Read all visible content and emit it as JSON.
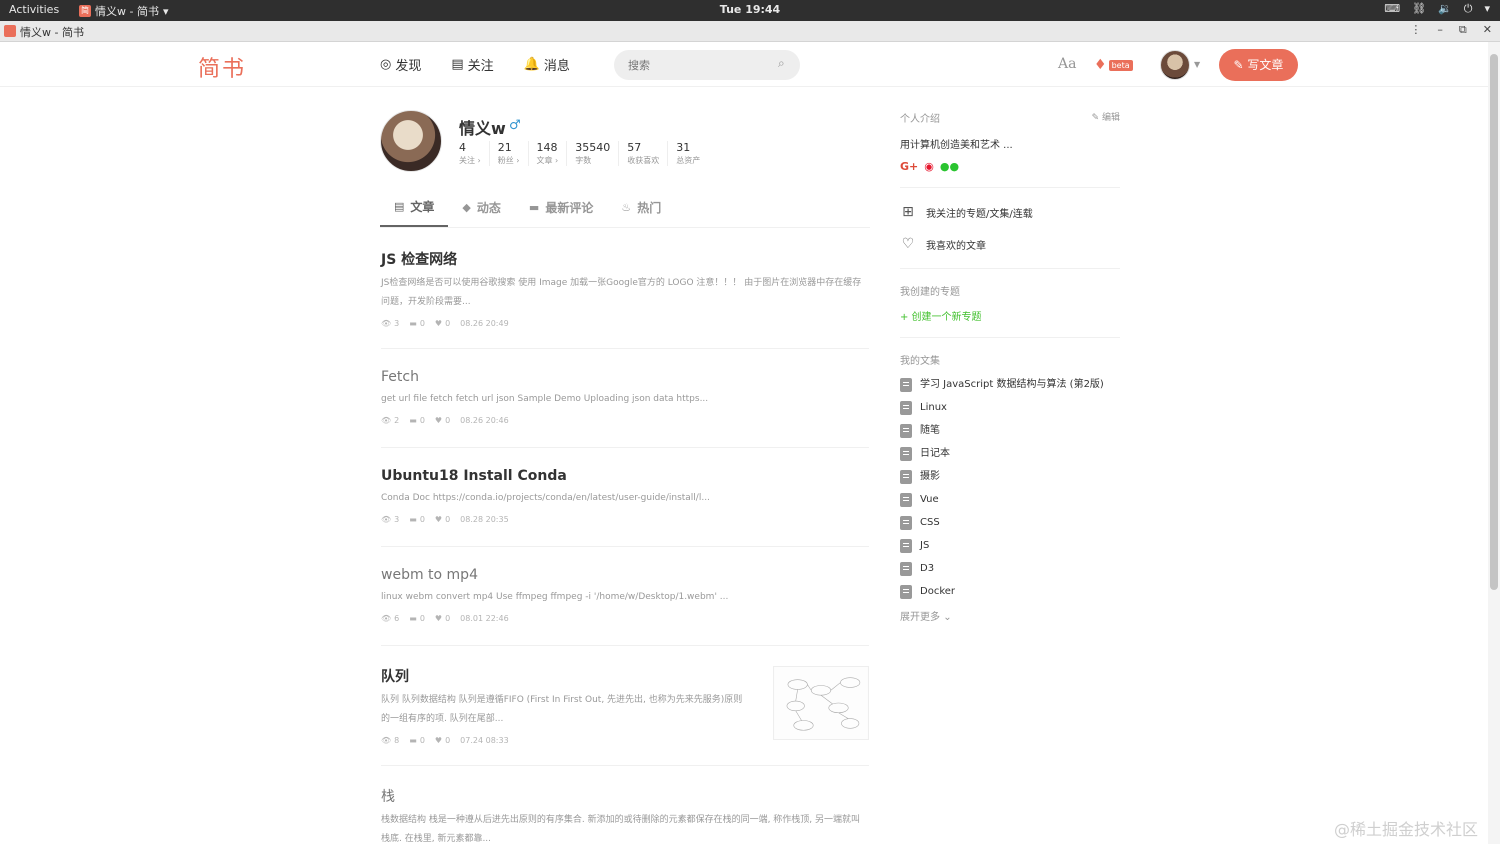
{
  "gnome": {
    "activities": "Activities",
    "app": "情义w - 简书",
    "clock": "Tue 19:44"
  },
  "browser": {
    "title": "情义w - 简书"
  },
  "header": {
    "logo": "简书",
    "nav": [
      {
        "icon": "compass-icon",
        "glyph": "◎",
        "label": "发现"
      },
      {
        "icon": "follow-icon",
        "glyph": "▤",
        "label": "关注"
      },
      {
        "icon": "bell-icon",
        "glyph": "🔔",
        "label": "消息"
      }
    ],
    "search_placeholder": "搜索",
    "font_toggle": "Aa",
    "beta": "beta",
    "write_label": "写文章",
    "accent": "#ea6f5a"
  },
  "profile": {
    "name": "情义w",
    "gender_icon": "♂",
    "stats": [
      {
        "num": "4",
        "label": "关注 ›"
      },
      {
        "num": "21",
        "label": "粉丝 ›"
      },
      {
        "num": "148",
        "label": "文章 ›"
      },
      {
        "num": "35540",
        "label": "字数"
      },
      {
        "num": "57",
        "label": "收获喜欢"
      },
      {
        "num": "31",
        "label": "总资产"
      }
    ]
  },
  "tabs": [
    {
      "icon": "article-icon",
      "glyph": "▤",
      "label": "文章"
    },
    {
      "icon": "feed-icon",
      "glyph": "◆",
      "label": "动态"
    },
    {
      "icon": "comment-icon",
      "glyph": "▬",
      "label": "最新评论"
    },
    {
      "icon": "fire-icon",
      "glyph": "♨",
      "label": "热门"
    }
  ],
  "articles": [
    {
      "title": "JS 检查网络",
      "abstract": "JS检查网络是否可以使用谷歌搜索 使用 Image 加载一张Google官方的 LOGO 注意！！！ 由于图片在浏览器中存在缓存问题，开发阶段需要...",
      "views": "3",
      "comments": "0",
      "likes": "0",
      "time": "08.26 20:49"
    },
    {
      "title": "Fetch",
      "abstract": "get url file fetch fetch url json Sample Demo Uploading json data https...",
      "views": "2",
      "comments": "0",
      "likes": "0",
      "time": "08.26 20:46"
    },
    {
      "title": "Ubuntu18 Install Conda",
      "abstract": "Conda Doc https://conda.io/projects/conda/en/latest/user-guide/install/l...",
      "views": "3",
      "comments": "0",
      "likes": "0",
      "time": "08.28 20:35"
    },
    {
      "title": "webm to mp4",
      "abstract": "linux webm convert mp4 Use ffmpeg ffmpeg -i '/home/w/Desktop/1.webm' ...",
      "views": "6",
      "comments": "0",
      "likes": "0",
      "time": "08.01 22:46"
    },
    {
      "title": "队列",
      "abstract": "队列 队列数据结构 队列是遵循FIFO (First In First Out, 先进先出, 也称为先来先服务)原则的一组有序的项. 队列在尾部...",
      "views": "8",
      "comments": "0",
      "likes": "0",
      "time": "07.24 08:33"
    },
    {
      "title": "栈",
      "abstract": "栈数据结构 栈是一种遵从后进先出原则的有序集合. 新添加的或待删除的元素都保存在栈的同一端, 称作栈顶, 另一端就叫栈底. 在栈里, 新元素都靠..."
    }
  ],
  "sidebar": {
    "intro_head": "个人介绍",
    "edit": "编辑",
    "intro": "用计算机创造美和艺术 ...",
    "links": [
      {
        "icon": "grid-icon",
        "glyph": "⊞",
        "label": "我关注的专题/文集/连载"
      },
      {
        "icon": "heart-icon",
        "glyph": "♡",
        "label": "我喜欢的文章"
      }
    ],
    "topics_head": "我创建的专题",
    "new_topic": "+ 创建一个新专题",
    "collections_head": "我的文集",
    "collections": [
      "学习 JavaScript 数据结构与算法 (第2版)",
      "Linux",
      "随笔",
      "日记本",
      "摄影",
      "Vue",
      "CSS",
      "JS",
      "D3",
      "Docker"
    ],
    "more": "展开更多"
  },
  "watermark": "@稀土掘金技术社区"
}
